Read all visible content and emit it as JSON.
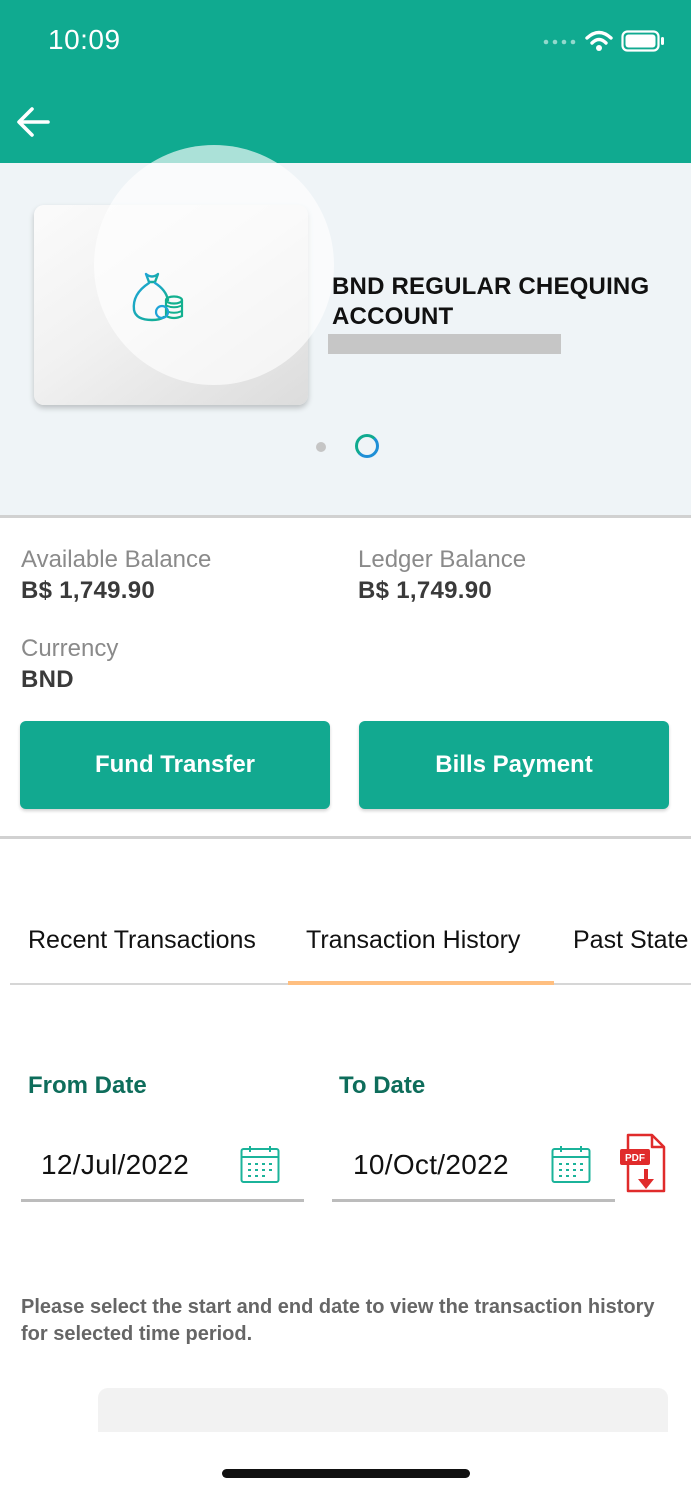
{
  "status_bar": {
    "time": "10:09"
  },
  "account": {
    "name": "BND REGULAR CHEQUING ACCOUNT"
  },
  "balances": {
    "available_label": "Available Balance",
    "available_value": "B$ 1,749.90",
    "ledger_label": "Ledger Balance",
    "ledger_value": "B$ 1,749.90",
    "currency_label": "Currency",
    "currency_value": "BND"
  },
  "actions": {
    "fund_transfer": "Fund Transfer",
    "bills_payment": "Bills Payment"
  },
  "tabs": [
    {
      "label": "Recent Transactions",
      "active": false
    },
    {
      "label": "Transaction History",
      "active": true
    },
    {
      "label": "Past State",
      "active": false
    }
  ],
  "filter": {
    "from_label": "From Date",
    "from_value": "12/Jul/2022",
    "to_label": "To Date",
    "to_value": "10/Oct/2022",
    "pdf_icon_text": "PDF"
  },
  "hint": "Please select the start and end date to view the transaction history for selected time period.",
  "colors": {
    "primary": "#10aa90",
    "tab_indicator": "#ffbf80",
    "date_label": "#0e6d5b",
    "pdf_red": "#e02b2b"
  }
}
